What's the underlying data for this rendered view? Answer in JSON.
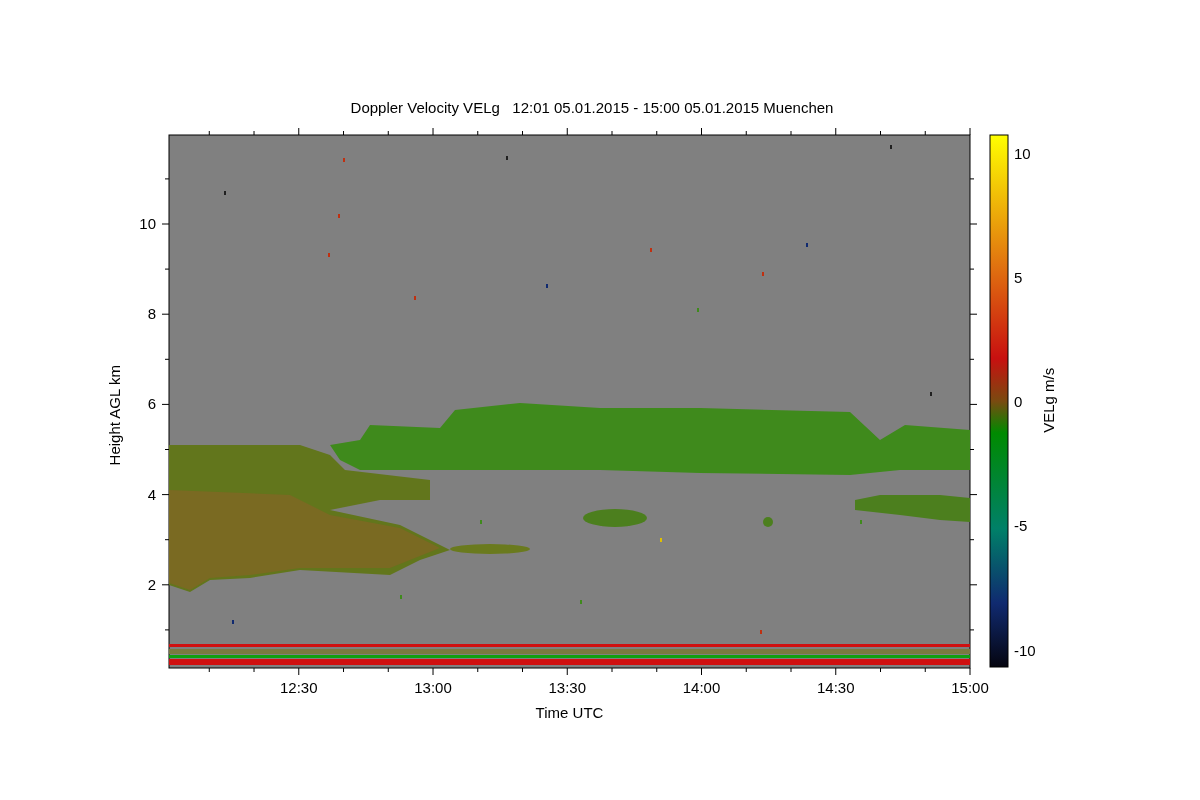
{
  "title": "Doppler Velocity VELg   12:01 05.01.2015 - 15:00 05.01.2015 Muenchen",
  "y_axis": {
    "label": "Height AGL km",
    "ticks": [
      "10",
      "8",
      "6",
      "4",
      "2"
    ]
  },
  "x_axis": {
    "label": "Time UTC",
    "ticks": [
      "12:30",
      "13:00",
      "13:30",
      "14:00",
      "14:30",
      "15:00"
    ]
  },
  "colorbar": {
    "label": "VELg m/s",
    "ticks": [
      "10",
      "5",
      "0",
      "-5",
      "-10"
    ]
  }
}
